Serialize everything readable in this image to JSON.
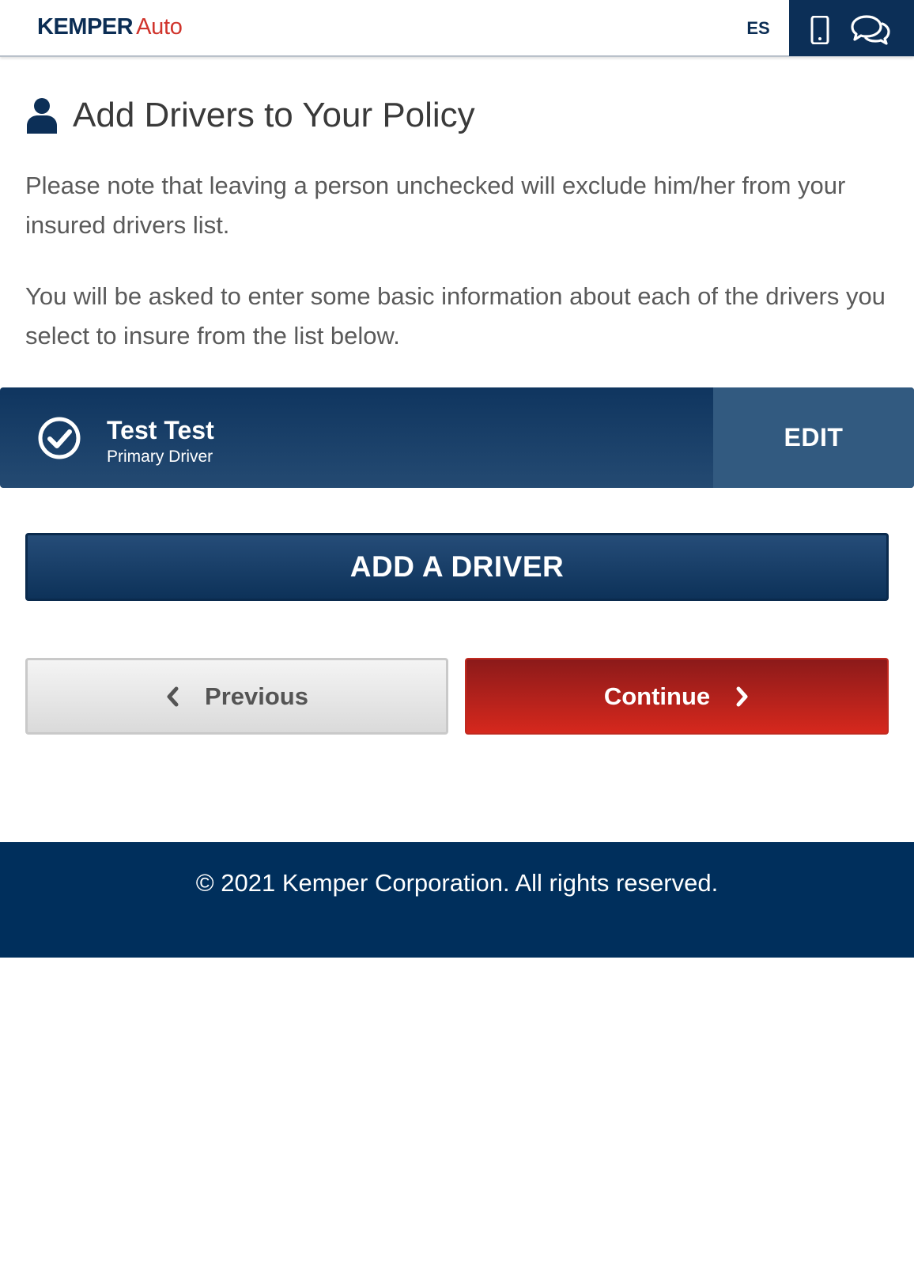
{
  "header": {
    "logo": {
      "brand": "KEMPER",
      "product": "Auto"
    },
    "language_toggle": "ES",
    "icons": [
      "mobile-phone-icon",
      "chat-bubbles-icon"
    ]
  },
  "main": {
    "title": "Add Drivers to Your Policy",
    "title_icon": "person-icon",
    "paragraph_1": "Please note that leaving a person unchecked will exclude him/her from your insured drivers list.",
    "paragraph_2": "You will be asked to enter some basic information about each of the drivers you select to insure from the list below.",
    "drivers": [
      {
        "name": "Test Test",
        "role": "Primary Driver",
        "checked": true,
        "edit_label": "EDIT"
      }
    ],
    "add_driver_label": "ADD A DRIVER",
    "previous_label": "Previous",
    "continue_label": "Continue"
  },
  "footer": {
    "copyright": "© 2021 Kemper Corporation. All rights reserved."
  },
  "colors": {
    "navy": "#0c2f57",
    "brand_red": "#d0342c",
    "continue_red": "#d6281d",
    "footer_bg": "#002f5c"
  }
}
